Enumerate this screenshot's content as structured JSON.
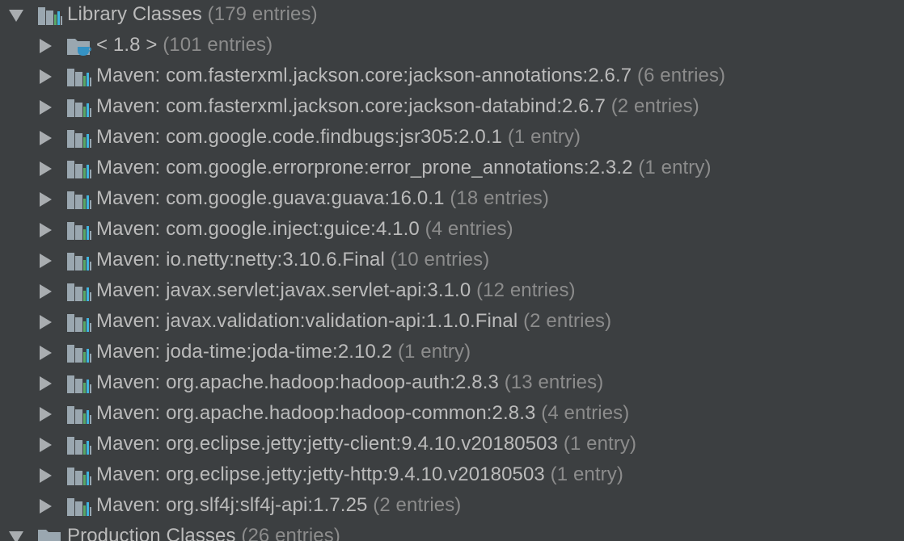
{
  "library": {
    "label": "Library Classes",
    "count": "(179 entries)"
  },
  "jdk": {
    "label": "< 1.8 >",
    "count": "(101 entries)"
  },
  "items": [
    {
      "label": "Maven: com.fasterxml.jackson.core:jackson-annotations:2.6.7",
      "count": "(6 entries)"
    },
    {
      "label": "Maven: com.fasterxml.jackson.core:jackson-databind:2.6.7",
      "count": "(2 entries)"
    },
    {
      "label": "Maven: com.google.code.findbugs:jsr305:2.0.1",
      "count": "(1 entry)"
    },
    {
      "label": "Maven: com.google.errorprone:error_prone_annotations:2.3.2",
      "count": "(1 entry)"
    },
    {
      "label": "Maven: com.google.guava:guava:16.0.1",
      "count": "(18 entries)"
    },
    {
      "label": "Maven: com.google.inject:guice:4.1.0",
      "count": "(4 entries)"
    },
    {
      "label": "Maven: io.netty:netty:3.10.6.Final",
      "count": "(10 entries)"
    },
    {
      "label": "Maven: javax.servlet:javax.servlet-api:3.1.0",
      "count": "(12 entries)"
    },
    {
      "label": "Maven: javax.validation:validation-api:1.1.0.Final",
      "count": "(2 entries)"
    },
    {
      "label": "Maven: joda-time:joda-time:2.10.2",
      "count": "(1 entry)"
    },
    {
      "label": "Maven: org.apache.hadoop:hadoop-auth:2.8.3",
      "count": "(13 entries)"
    },
    {
      "label": "Maven: org.apache.hadoop:hadoop-common:2.8.3",
      "count": "(4 entries)"
    },
    {
      "label": "Maven: org.eclipse.jetty:jetty-client:9.4.10.v20180503",
      "count": "(1 entry)"
    },
    {
      "label": "Maven: org.eclipse.jetty:jetty-http:9.4.10.v20180503",
      "count": "(1 entry)"
    },
    {
      "label": "Maven: org.slf4j:slf4j-api:1.7.25",
      "count": "(2 entries)"
    }
  ],
  "production": {
    "label": "Production Classes",
    "count": "(26 entries)"
  },
  "colors": {
    "background": "#3c3f41",
    "text": "#bbbbbb",
    "count_text": "#8c8c8c",
    "folder_gray": "#9aa7b0",
    "bar_green": "#59a869",
    "bar_blue": "#40b6e0",
    "java_cup_blue": "#3592c4"
  },
  "icons": {
    "library_icon": "library-icon",
    "jdk_icon": "jdk-folder-icon",
    "maven_icon": "maven-library-icon",
    "production_icon": "production-folder-icon",
    "expand": "chevron-down-icon",
    "collapse": "chevron-right-icon"
  }
}
